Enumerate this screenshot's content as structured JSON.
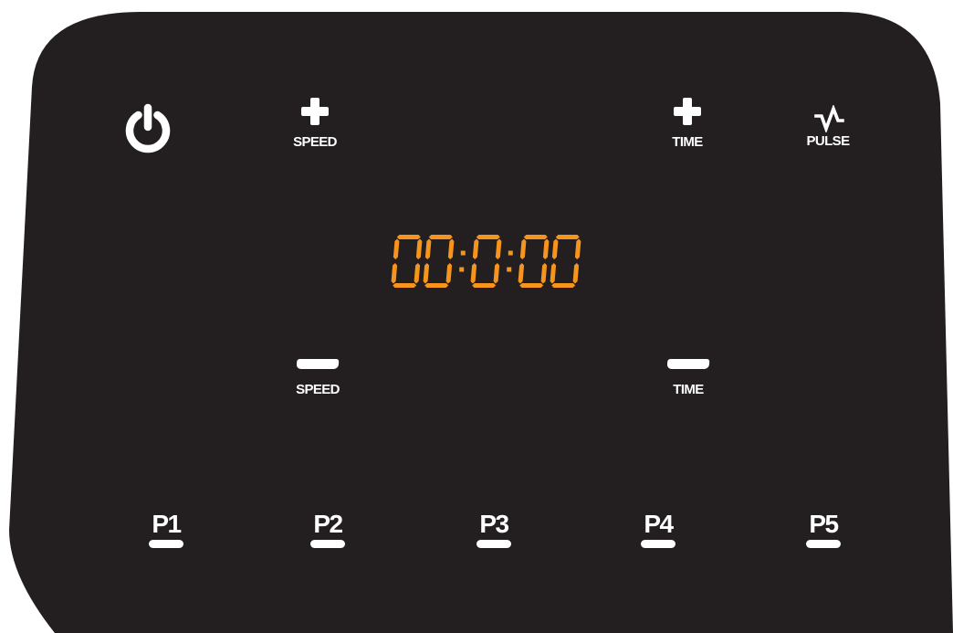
{
  "device": {
    "panel_color": "#231f20",
    "accent_color": "#f7941d",
    "foreground_color": "#ffffff"
  },
  "controls": {
    "power": {
      "icon": "power-icon"
    },
    "speed_up": {
      "icon": "plus-icon",
      "label": "SPEED"
    },
    "speed_down": {
      "icon": "minus-icon",
      "label": "SPEED"
    },
    "time_up": {
      "icon": "plus-icon",
      "label": "TIME"
    },
    "time_down": {
      "icon": "minus-icon",
      "label": "TIME"
    },
    "pulse": {
      "icon": "pulse-wave-icon",
      "label": "PULSE"
    }
  },
  "display": {
    "value": "00:0:00",
    "color": "#f7941d",
    "style": "seven-segment"
  },
  "presets": [
    {
      "label": "P1"
    },
    {
      "label": "P2"
    },
    {
      "label": "P3"
    },
    {
      "label": "P4"
    },
    {
      "label": "P5"
    }
  ]
}
